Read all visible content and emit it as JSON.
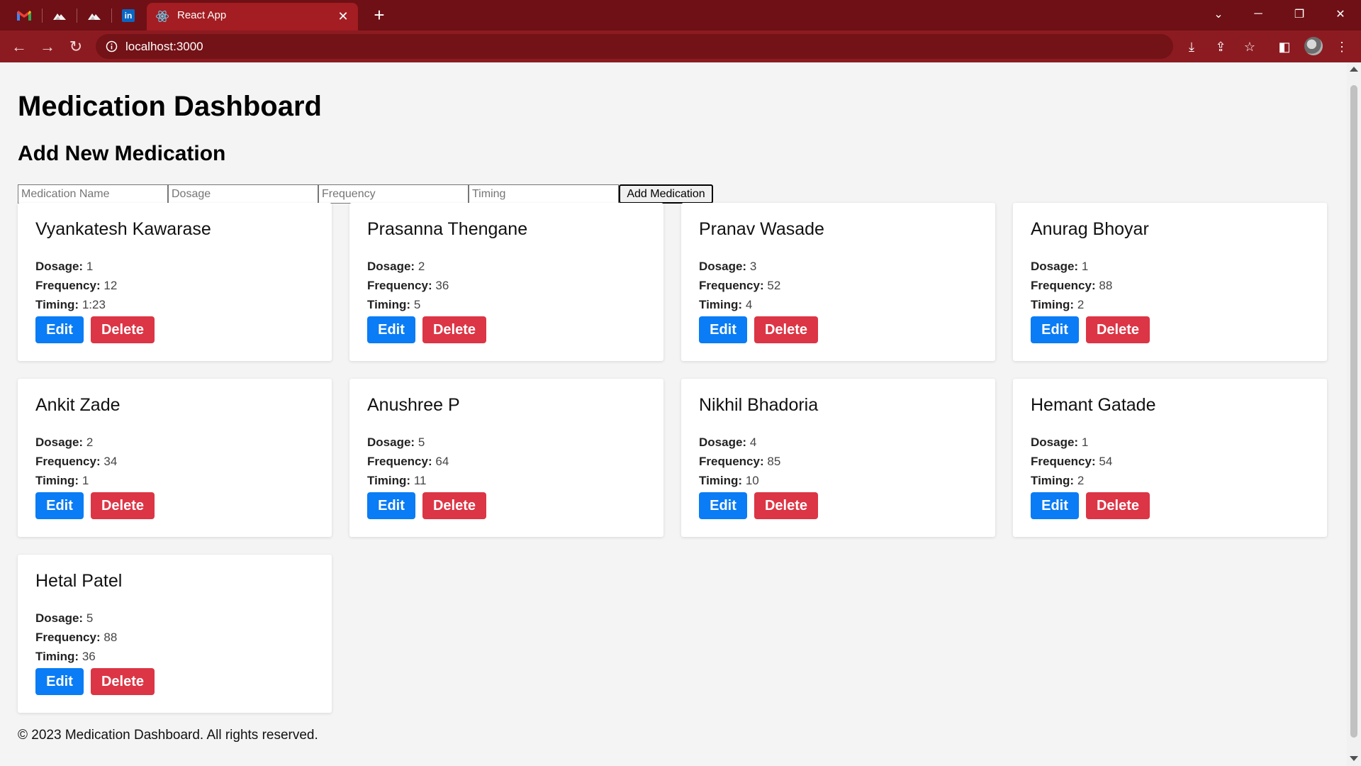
{
  "browser": {
    "tab_title": "React App",
    "url": "localhost:3000",
    "close_glyph": "✕",
    "new_tab_glyph": "+",
    "window_controls": {
      "dropdown": "⌄",
      "minimize": "─",
      "restore": "❐",
      "close": "✕"
    },
    "pinned_tabs": [
      "gmail-icon",
      "cloud-icon",
      "cloud-icon",
      "linkedin-icon"
    ],
    "linkedin_text": "in",
    "colors": {
      "tabbar": "#6e1015",
      "toolbar": "#8c1b21",
      "active_tab": "#a31d22"
    }
  },
  "page": {
    "title": "Medication Dashboard",
    "form_title": "Add New Medication",
    "form": {
      "name_placeholder": "Medication Name",
      "dosage_placeholder": "Dosage",
      "frequency_placeholder": "Frequency",
      "timing_placeholder": "Timing",
      "name_value": "",
      "dosage_value": "",
      "frequency_value": "",
      "timing_value": "",
      "submit_label": "Add Medication"
    },
    "labels": {
      "dosage": "Dosage:",
      "frequency": "Frequency:",
      "timing": "Timing:",
      "edit": "Edit",
      "delete": "Delete"
    },
    "medications": [
      {
        "name": "Vyankatesh Kawarase",
        "dosage": "1",
        "frequency": "12",
        "timing": "1:23"
      },
      {
        "name": "Prasanna Thengane",
        "dosage": "2",
        "frequency": "36",
        "timing": "5"
      },
      {
        "name": "Pranav Wasade",
        "dosage": "3",
        "frequency": "52",
        "timing": "4"
      },
      {
        "name": "Anurag Bhoyar",
        "dosage": "1",
        "frequency": "88",
        "timing": "2"
      },
      {
        "name": "Ankit Zade",
        "dosage": "2",
        "frequency": "34",
        "timing": "1"
      },
      {
        "name": "Anushree P",
        "dosage": "5",
        "frequency": "64",
        "timing": "11"
      },
      {
        "name": "Nikhil Bhadoria",
        "dosage": "4",
        "frequency": "85",
        "timing": "10"
      },
      {
        "name": "Hemant Gatade",
        "dosage": "1",
        "frequency": "54",
        "timing": "2"
      },
      {
        "name": "Hetal Patel",
        "dosage": "5",
        "frequency": "88",
        "timing": "36"
      }
    ],
    "footer": "© 2023 Medication Dashboard. All rights reserved.",
    "colors": {
      "edit": "#0a7cf5",
      "delete": "#dc3545",
      "background": "#f4f4f4"
    }
  }
}
